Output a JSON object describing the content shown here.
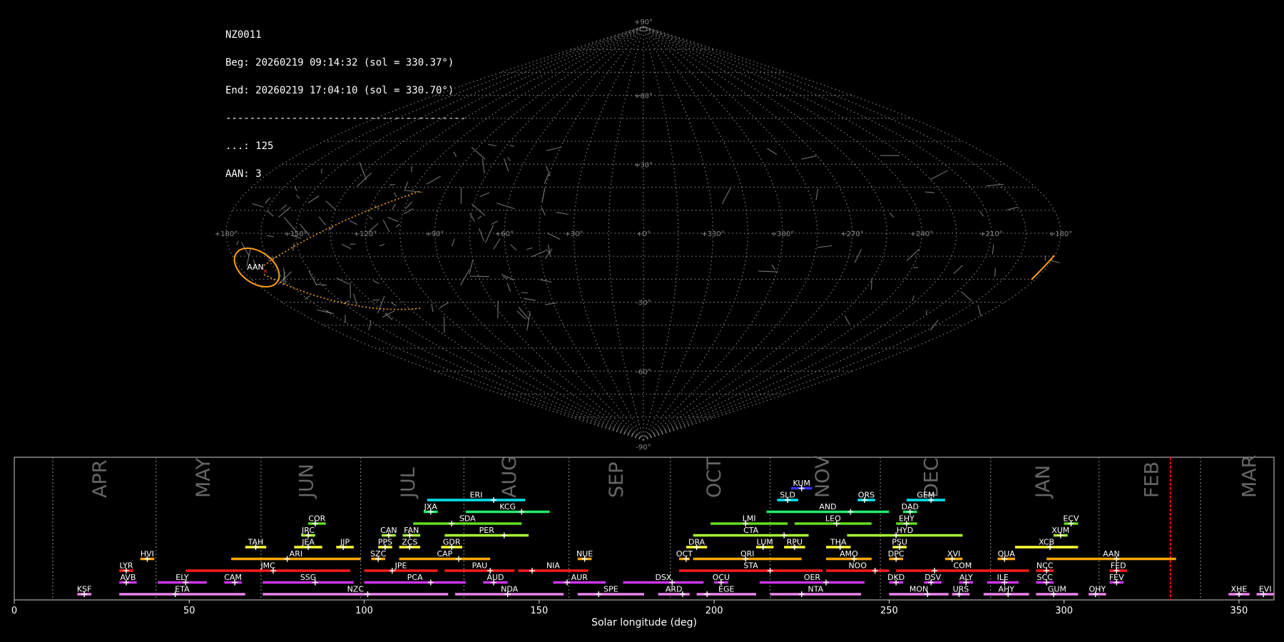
{
  "info": {
    "lines": [
      "NZ0011",
      "Beg: 20260219 09:14:32 (sol = 330.37°)",
      "End: 20260219 17:04:10 (sol = 330.70°)",
      "----------------------------------------",
      "...: 125",
      "AAN: 3"
    ]
  },
  "sky_map": {
    "projection": "sinusoidal",
    "lon_labels": [
      "+180°",
      "+150°",
      "+120°",
      "+90°",
      "+60°",
      "+30°",
      "+0°",
      "+330°",
      "+300°",
      "+270°",
      "+240°",
      "+210°",
      "+180°"
    ],
    "lat_labels": [
      "+90°",
      "+60°",
      "+30°",
      "-30°",
      "-60°",
      "-90°"
    ],
    "highlight_label": "AAN",
    "highlight_color": "#ff9f1a",
    "grid_color": "#777777"
  },
  "chart_data": {
    "type": "timeline",
    "xlabel": "Solar longitude (deg)",
    "xlim": [
      0,
      360
    ],
    "xticks": [
      0,
      50,
      100,
      150,
      200,
      250,
      300,
      350
    ],
    "current_sol": 330.37,
    "current_marker_color": "#ff0000",
    "months": [
      {
        "name": "APR",
        "center": 24.5,
        "boundary": 11
      },
      {
        "name": "MAY",
        "center": 54,
        "boundary": 40.5
      },
      {
        "name": "JUN",
        "center": 83.5,
        "boundary": 70.5
      },
      {
        "name": "JUL",
        "center": 112.5,
        "boundary": 99
      },
      {
        "name": "AUG",
        "center": 141.5,
        "boundary": 128.5
      },
      {
        "name": "SEP",
        "center": 172,
        "boundary": 158.5
      },
      {
        "name": "OCT",
        "center": 200,
        "boundary": 187.5
      },
      {
        "name": "NOV",
        "center": 231,
        "boundary": 216
      },
      {
        "name": "DEC",
        "center": 262,
        "boundary": 247.5
      },
      {
        "name": "JAN",
        "center": 294,
        "boundary": 279
      },
      {
        "name": "FEB",
        "center": 325,
        "boundary": 310
      },
      {
        "name": "MAR",
        "center": 353,
        "boundary": 339
      }
    ],
    "row_colors": [
      "#ee82ee",
      "#cc33ee",
      "#ff1a1a",
      "#ffa500",
      "#ffff33",
      "#aaff33",
      "#66dd22",
      "#22ee66",
      "#00e5ee",
      "#3333ff"
    ],
    "showers": [
      {
        "name": "KSF",
        "row": 0,
        "start": 18,
        "end": 22,
        "peak": 20
      },
      {
        "name": "ETA",
        "row": 0,
        "start": 30,
        "end": 66,
        "peak": 46
      },
      {
        "name": "NZC",
        "row": 0,
        "start": 71,
        "end": 124,
        "peak": 101
      },
      {
        "name": "NDA",
        "row": 0,
        "start": 126,
        "end": 157,
        "peak": 141
      },
      {
        "name": "SPE",
        "row": 0,
        "start": 161,
        "end": 180,
        "peak": 167
      },
      {
        "name": "ARD",
        "row": 0,
        "start": 184,
        "end": 193,
        "peak": 191
      },
      {
        "name": "EGE",
        "row": 0,
        "start": 195,
        "end": 212,
        "peak": 198
      },
      {
        "name": "NTA",
        "row": 0,
        "start": 216,
        "end": 242,
        "peak": 225
      },
      {
        "name": "MON",
        "row": 0,
        "start": 250,
        "end": 267,
        "peak": 261
      },
      {
        "name": "URS",
        "row": 0,
        "start": 268,
        "end": 273,
        "peak": 270
      },
      {
        "name": "AHY",
        "row": 0,
        "start": 277,
        "end": 290,
        "peak": 284
      },
      {
        "name": "GUM",
        "row": 0,
        "start": 292,
        "end": 304,
        "peak": 297
      },
      {
        "name": "OHY",
        "row": 0,
        "start": 307,
        "end": 312,
        "peak": 309
      },
      {
        "name": "XHE",
        "row": 0,
        "start": 347,
        "end": 353,
        "peak": 350
      },
      {
        "name": "EVI",
        "row": 0,
        "start": 355,
        "end": 360,
        "peak": 357
      },
      {
        "name": "AVB",
        "row": 1,
        "start": 30,
        "end": 35,
        "peak": 32
      },
      {
        "name": "ELY",
        "row": 1,
        "start": 41,
        "end": 55,
        "peak": 49
      },
      {
        "name": "CAM",
        "row": 1,
        "start": 60,
        "end": 65,
        "peak": 63
      },
      {
        "name": "SSG",
        "row": 1,
        "start": 71,
        "end": 97,
        "peak": 86
      },
      {
        "name": "PCA",
        "row": 1,
        "start": 100,
        "end": 129,
        "peak": 119
      },
      {
        "name": "AUD",
        "row": 1,
        "start": 134,
        "end": 141,
        "peak": 137
      },
      {
        "name": "AUR",
        "row": 1,
        "start": 154,
        "end": 169,
        "peak": 158
      },
      {
        "name": "DSX",
        "row": 1,
        "start": 174,
        "end": 197,
        "peak": 188
      },
      {
        "name": "OCU",
        "row": 1,
        "start": 200,
        "end": 204,
        "peak": 202
      },
      {
        "name": "OER",
        "row": 1,
        "start": 213,
        "end": 243,
        "peak": 232
      },
      {
        "name": "DKD",
        "row": 1,
        "start": 250,
        "end": 254,
        "peak": 252
      },
      {
        "name": "DSV",
        "row": 1,
        "start": 260,
        "end": 265,
        "peak": 262
      },
      {
        "name": "ALY",
        "row": 1,
        "start": 270,
        "end": 274,
        "peak": 272
      },
      {
        "name": "ILE",
        "row": 1,
        "start": 278,
        "end": 287,
        "peak": 283
      },
      {
        "name": "SCC",
        "row": 1,
        "start": 292,
        "end": 297,
        "peak": 295
      },
      {
        "name": "FEV",
        "row": 1,
        "start": 313,
        "end": 317,
        "peak": 315
      },
      {
        "name": "LYR",
        "row": 2,
        "start": 30,
        "end": 34,
        "peak": 32
      },
      {
        "name": "JMC",
        "row": 2,
        "start": 49,
        "end": 96,
        "peak": 74
      },
      {
        "name": "JPE",
        "row": 2,
        "start": 100,
        "end": 121,
        "peak": 108
      },
      {
        "name": "PAU",
        "row": 2,
        "start": 123,
        "end": 143,
        "peak": 136
      },
      {
        "name": "NIA",
        "row": 2,
        "start": 144,
        "end": 164,
        "peak": 148
      },
      {
        "name": "STA",
        "row": 2,
        "start": 190,
        "end": 231,
        "peak": 216
      },
      {
        "name": "NOO",
        "row": 2,
        "start": 232,
        "end": 250,
        "peak": 246
      },
      {
        "name": "COM",
        "row": 2,
        "start": 252,
        "end": 290,
        "peak": 263
      },
      {
        "name": "NCC",
        "row": 2,
        "start": 292,
        "end": 297,
        "peak": 295
      },
      {
        "name": "FED",
        "row": 2,
        "start": 313,
        "end": 318,
        "peak": 315
      },
      {
        "name": "HVI",
        "row": 3,
        "start": 36,
        "end": 40,
        "peak": 38
      },
      {
        "name": "ARI",
        "row": 3,
        "start": 62,
        "end": 99,
        "peak": 78
      },
      {
        "name": "SZC",
        "row": 3,
        "start": 102,
        "end": 106,
        "peak": 104
      },
      {
        "name": "CAP",
        "row": 3,
        "start": 110,
        "end": 136,
        "peak": 127
      },
      {
        "name": "NUE",
        "row": 3,
        "start": 161,
        "end": 165,
        "peak": 163
      },
      {
        "name": "OCT",
        "row": 3,
        "start": 190,
        "end": 193,
        "peak": 192
      },
      {
        "name": "ORI",
        "row": 3,
        "start": 194,
        "end": 225,
        "peak": 209
      },
      {
        "name": "AMO",
        "row": 3,
        "start": 232,
        "end": 245,
        "peak": 240
      },
      {
        "name": "DPC",
        "row": 3,
        "start": 250,
        "end": 254,
        "peak": 252
      },
      {
        "name": "XVI",
        "row": 3,
        "start": 266,
        "end": 271,
        "peak": 268
      },
      {
        "name": "QUA",
        "row": 3,
        "start": 281,
        "end": 286,
        "peak": 283
      },
      {
        "name": "AAN",
        "row": 3,
        "start": 295,
        "end": 332,
        "peak": 315
      },
      {
        "name": "TAH",
        "row": 4,
        "start": 66,
        "end": 72,
        "peak": 69
      },
      {
        "name": "JEA",
        "row": 4,
        "start": 80,
        "end": 88,
        "peak": 84
      },
      {
        "name": "JIP",
        "row": 4,
        "start": 92,
        "end": 97,
        "peak": 94
      },
      {
        "name": "PPS",
        "row": 4,
        "start": 104,
        "end": 108,
        "peak": 106
      },
      {
        "name": "ZCS",
        "row": 4,
        "start": 110,
        "end": 116,
        "peak": 113
      },
      {
        "name": "GDR",
        "row": 4,
        "start": 122,
        "end": 128,
        "peak": 125
      },
      {
        "name": "DRA",
        "row": 4,
        "start": 192,
        "end": 198,
        "peak": 195
      },
      {
        "name": "LUM",
        "row": 4,
        "start": 212,
        "end": 217,
        "peak": 214
      },
      {
        "name": "RPU",
        "row": 4,
        "start": 220,
        "end": 226,
        "peak": 223
      },
      {
        "name": "THA",
        "row": 4,
        "start": 232,
        "end": 239,
        "peak": 236
      },
      {
        "name": "PSU",
        "row": 4,
        "start": 251,
        "end": 255,
        "peak": 253
      },
      {
        "name": "XCB",
        "row": 4,
        "start": 286,
        "end": 304,
        "peak": 296
      },
      {
        "name": "JRC",
        "row": 5,
        "start": 82,
        "end": 86,
        "peak": 84
      },
      {
        "name": "CAN",
        "row": 5,
        "start": 105,
        "end": 109,
        "peak": 107
      },
      {
        "name": "FAN",
        "row": 5,
        "start": 111,
        "end": 116,
        "peak": 113
      },
      {
        "name": "PER",
        "row": 5,
        "start": 123,
        "end": 147,
        "peak": 140
      },
      {
        "name": "CTA",
        "row": 5,
        "start": 194,
        "end": 227,
        "peak": 220
      },
      {
        "name": "HYD",
        "row": 5,
        "start": 238,
        "end": 271,
        "peak": 252
      },
      {
        "name": "XUM",
        "row": 5,
        "start": 297,
        "end": 301,
        "peak": 299
      },
      {
        "name": "COR",
        "row": 6,
        "start": 84,
        "end": 89,
        "peak": 86
      },
      {
        "name": "SDA",
        "row": 6,
        "start": 114,
        "end": 145,
        "peak": 125
      },
      {
        "name": "LMI",
        "row": 6,
        "start": 199,
        "end": 221,
        "peak": 209
      },
      {
        "name": "LEO",
        "row": 6,
        "start": 223,
        "end": 245,
        "peak": 235
      },
      {
        "name": "EHY",
        "row": 6,
        "start": 252,
        "end": 258,
        "peak": 255
      },
      {
        "name": "ECV",
        "row": 6,
        "start": 300,
        "end": 304,
        "peak": 302
      },
      {
        "name": "JXA",
        "row": 7,
        "start": 117,
        "end": 121,
        "peak": 119
      },
      {
        "name": "KCG",
        "row": 7,
        "start": 129,
        "end": 153,
        "peak": 145
      },
      {
        "name": "AND",
        "row": 7,
        "start": 215,
        "end": 250,
        "peak": 239
      },
      {
        "name": "DAD",
        "row": 7,
        "start": 254,
        "end": 258,
        "peak": 256
      },
      {
        "name": "ERI",
        "row": 8,
        "start": 118,
        "end": 146,
        "peak": 137
      },
      {
        "name": "SLD",
        "row": 8,
        "start": 218,
        "end": 224,
        "peak": 221
      },
      {
        "name": "ORS",
        "row": 8,
        "start": 241,
        "end": 246,
        "peak": 243
      },
      {
        "name": "GEM",
        "row": 8,
        "start": 255,
        "end": 266,
        "peak": 262
      },
      {
        "name": "KUM",
        "row": 9,
        "start": 222,
        "end": 228,
        "peak": 225
      }
    ]
  }
}
